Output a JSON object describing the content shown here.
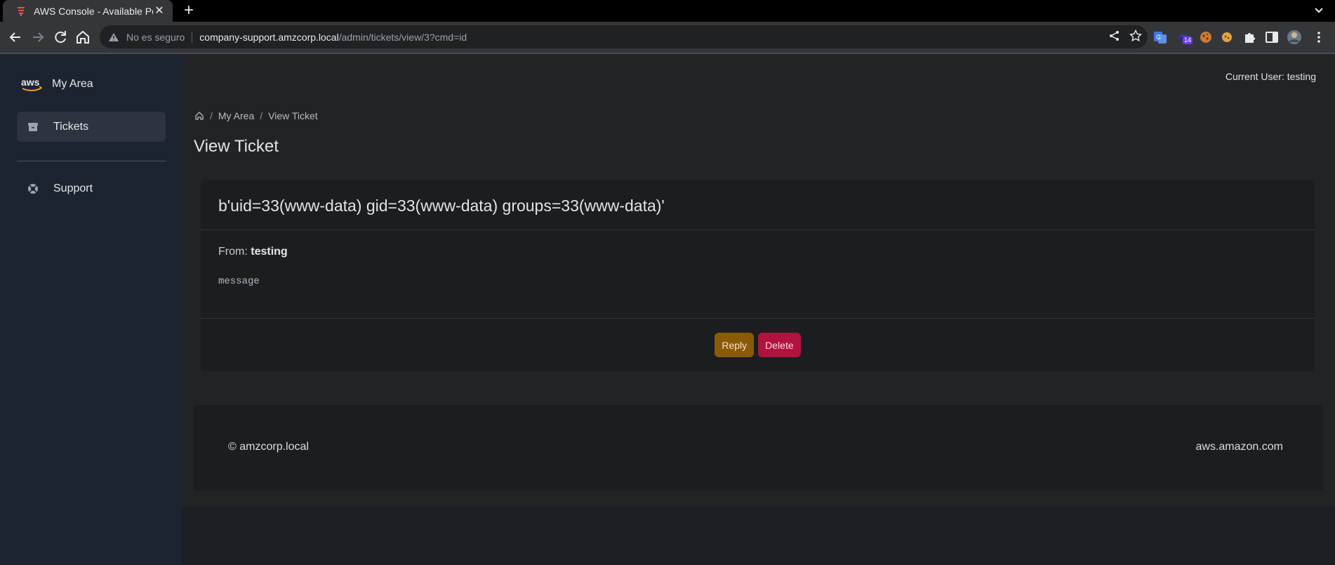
{
  "browser": {
    "tab_title": "AWS Console - Available Positions",
    "insecure_label": "No es seguro",
    "url_host": "company-support.amzcorp.local",
    "url_path": "/admin/tickets/view/3?cmd=id",
    "extension_badge": "14"
  },
  "sidebar": {
    "brand": "My Area",
    "items": [
      {
        "label": "Tickets",
        "icon": "archive-icon"
      },
      {
        "label": "Support",
        "icon": "lifebuoy-icon"
      }
    ]
  },
  "header": {
    "current_user": "Current User: testing"
  },
  "breadcrumb": {
    "level1": "My Area",
    "level2": "View Ticket",
    "separator": "/"
  },
  "page": {
    "title": "View Ticket"
  },
  "ticket": {
    "subject": "b'uid=33(www-data) gid=33(www-data) groups=33(www-data)'",
    "from_label": "From:",
    "from_user": "testing",
    "message": "message",
    "reply_label": "Reply",
    "delete_label": "Delete"
  },
  "footer": {
    "left": "© amzcorp.local",
    "right": "aws.amazon.com"
  },
  "colors": {
    "reply": "#8b5a07",
    "delete": "#b2123e",
    "sidebar": "#1c2431"
  }
}
